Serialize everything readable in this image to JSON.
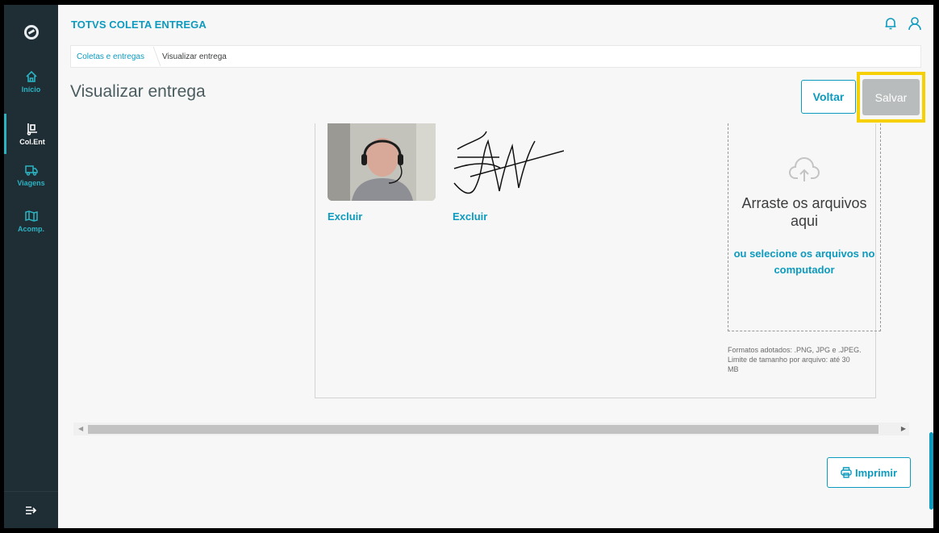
{
  "app": {
    "title": "TOTVS COLETA ENTREGA"
  },
  "sidebar": {
    "items": [
      {
        "label": "Início",
        "icon": "home-icon"
      },
      {
        "label": "Col.Ent",
        "icon": "dolly-icon"
      },
      {
        "label": "Viagens",
        "icon": "truck-icon"
      },
      {
        "label": "Acomp.",
        "icon": "map-icon"
      }
    ],
    "expand_icon": "expand-menu-icon"
  },
  "header": {
    "icons": [
      "bell-icon",
      "user-icon"
    ]
  },
  "breadcrumb": {
    "root": "Coletas e entregas",
    "current": "Visualizar entrega"
  },
  "page": {
    "title": "Visualizar entrega"
  },
  "actions": {
    "back_label": "Voltar",
    "save_label": "Salvar",
    "print_label": "Imprimir"
  },
  "attachments": {
    "delete_photo_label": "Excluir",
    "delete_signature_label": "Excluir"
  },
  "upload": {
    "title_line1": "Arraste os arquivos",
    "title_line2": "aqui",
    "link_line1": "ou selecione os arquivos no",
    "link_line2": "computador",
    "formats_text": "Formatos adotados: .PNG, JPG e .JPEG.",
    "limit_text": "Limite de tamanho por arquivo: até 30",
    "limit_unit": "MB"
  },
  "colors": {
    "accent": "#0c9abe",
    "sidebar": "#1f2d35",
    "highlight": "#f6d000",
    "save_disabled": "#b8bcbc"
  }
}
